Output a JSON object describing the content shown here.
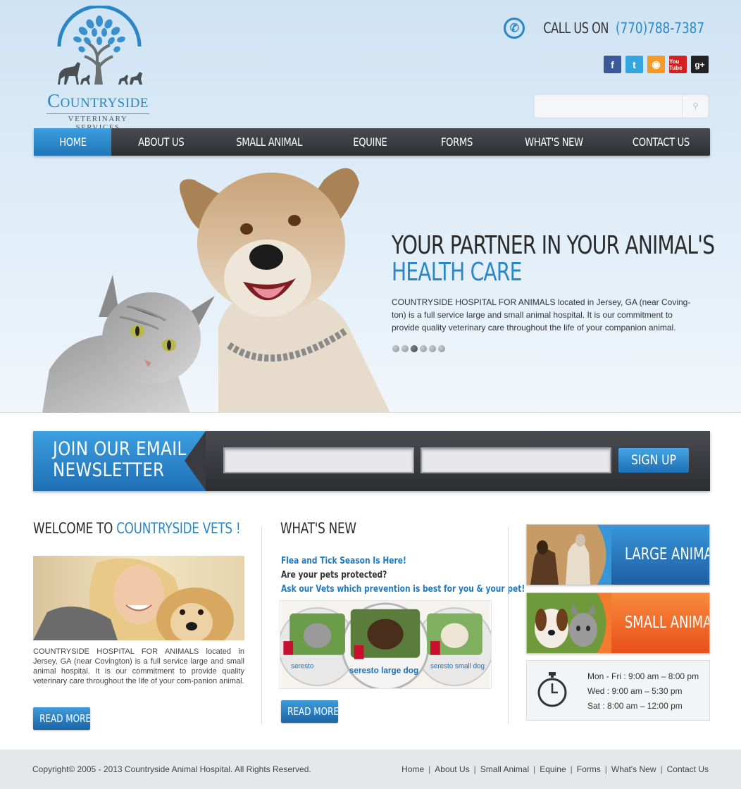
{
  "brand": {
    "name": "Countryside",
    "subtitle": "VETERINARY SERVICES"
  },
  "header": {
    "call_label": "CALL US ON",
    "phone": "(770)788-7387",
    "social_icons": [
      "facebook-icon",
      "twitter-icon",
      "rss-icon",
      "youtube-icon",
      "googleplus-icon"
    ],
    "social_glyphs": {
      "facebook": "f",
      "twitter": "t",
      "rss": "◉",
      "youtube": "You Tube",
      "googleplus": "g+"
    },
    "search_placeholder": "",
    "search_glyph": "🔍"
  },
  "nav": {
    "items": [
      "HOME",
      "ABOUT US",
      "SMALL ANIMAL",
      "EQUINE",
      "FORMS",
      "WHAT'S NEW",
      "CONTACT US"
    ],
    "active": "HOME"
  },
  "hero": {
    "title_line1": "YOUR PARTNER IN YOUR ANIMAL'S",
    "title_line2": "HEALTH CARE",
    "text": "COUNTRYSIDE HOSPITAL FOR ANIMALS  located in Jersey, GA (near Coving-ton) is a full service large and small animal hospital. It is our commitment to provide quality veterinary care throughout the life of your companion animal.",
    "slides": 6,
    "active_slide": 3
  },
  "newsletter": {
    "title_line1": "JOIN OUR EMAIL",
    "title_line2": "NEWSLETTER",
    "input1_value": "",
    "input2_value": "",
    "button": "SIGN UP"
  },
  "welcome": {
    "title_prefix": "WELCOME TO ",
    "title_highlight": "COUNTRYSIDE VETS !",
    "text": "COUNTRYSIDE HOSPITAL FOR ANIMALS  located in Jersey, GA (near Covington) is a full service large and small animal hospital. It is our commitment to provide quality veterinary care throughout the life of your com-panion animal.",
    "button": "READ MORE"
  },
  "whats_new": {
    "title": "WHAT'S NEW",
    "line1": "Flea and Tick Season Is Here!",
    "line2": "Are your pets protected?",
    "line3": "Ask our Vets which prevention is best for you & your pet!",
    "product_labels": [
      "seresto",
      "seresto large dog",
      "seresto small dog"
    ],
    "button": "READ MORE"
  },
  "sidebar": {
    "large_animal": "LARGE ANIMAL",
    "small_animal": "SMALL ANIMAL",
    "hours": [
      "Mon - Fri : 9:00 am – 8:00 pm",
      "Wed : 9:00 am – 5:30 pm",
      "Sat : 8:00 am – 12:00 pm"
    ]
  },
  "footer": {
    "copyright": "Copyright© 2005 - 2013 Countryside Animal Hospital. All Rights Reserved.",
    "links": [
      "Home",
      "About Us",
      "Small Animal",
      "Equine",
      "Forms",
      "What's New",
      "Contact Us"
    ]
  },
  "colors": {
    "accent_blue": "#2b86c5",
    "nav_dark": "#333438",
    "orange": "#f26a21"
  }
}
